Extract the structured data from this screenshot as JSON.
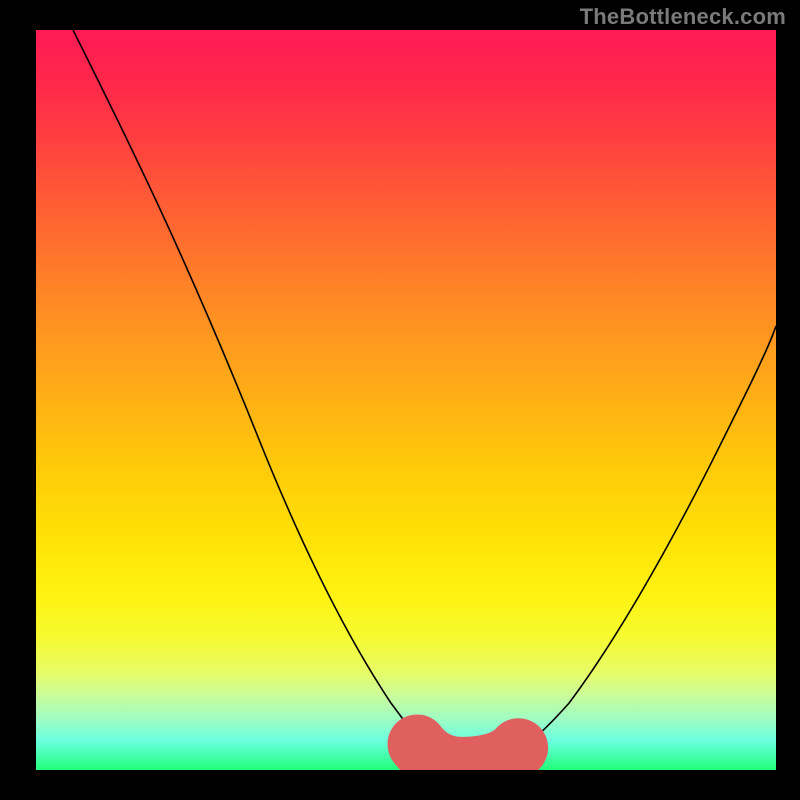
{
  "watermark": "TheBottleneck.com",
  "chart_data": {
    "type": "line",
    "title": "",
    "xlabel": "",
    "ylabel": "",
    "xlim": [
      0,
      100
    ],
    "ylim": [
      0,
      100
    ],
    "series": [
      {
        "name": "bottleneck-curve",
        "x": [
          5,
          10,
          15,
          20,
          25,
          30,
          35,
          40,
          45,
          50,
          53,
          56,
          59,
          62,
          65,
          70,
          75,
          80,
          85,
          90,
          95,
          100
        ],
        "y": [
          100,
          88,
          77,
          66,
          55,
          44,
          33,
          23,
          14,
          6,
          2,
          0,
          0,
          0,
          2,
          6,
          13,
          22,
          32,
          42,
          52,
          60
        ],
        "color": "#000000"
      },
      {
        "name": "optimal-zone-highlight",
        "x": [
          52,
          54,
          56,
          58,
          60,
          62,
          64
        ],
        "y": [
          2.5,
          0.8,
          0.2,
          0.2,
          0.3,
          0.8,
          2.2
        ],
        "color": "#e06060"
      }
    ],
    "annotations": []
  },
  "colors": {
    "gradient_top": "#ff1a55",
    "gradient_mid": "#ffe005",
    "gradient_bottom": "#20ff7a",
    "curve": "#000000",
    "highlight": "#e06060",
    "frame": "#000000"
  }
}
